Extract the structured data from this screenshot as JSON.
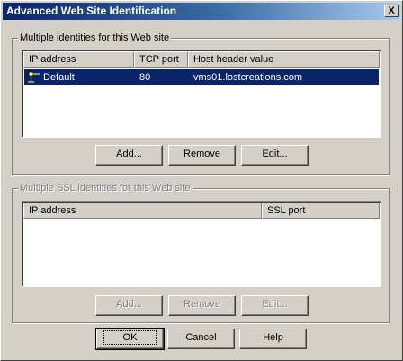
{
  "window": {
    "title": "Advanced Web Site Identification",
    "close_label": "X"
  },
  "identities": {
    "group_label": "Multiple identities for this Web site",
    "columns": [
      "IP address",
      "TCP port",
      "Host header value"
    ],
    "rows": [
      {
        "ip": "Default",
        "port": "80",
        "host": "vms01.lostcreations.com",
        "selected": true,
        "icon": "network-icon"
      }
    ],
    "buttons": {
      "add": "Add...",
      "remove": "Remove",
      "edit": "Edit..."
    }
  },
  "ssl": {
    "group_label": "Multiple SSL identities for this Web site",
    "columns": [
      "IP address",
      "SSL port"
    ],
    "rows": [],
    "buttons": {
      "add": "Add...",
      "remove": "Remove",
      "edit": "Edit..."
    },
    "disabled": true
  },
  "footer": {
    "ok": "OK",
    "cancel": "Cancel",
    "help": "Help"
  },
  "colors": {
    "title_start": "#0a246a",
    "title_end": "#a6caf0",
    "selection": "#0a246a",
    "face": "#d4d0c8"
  }
}
